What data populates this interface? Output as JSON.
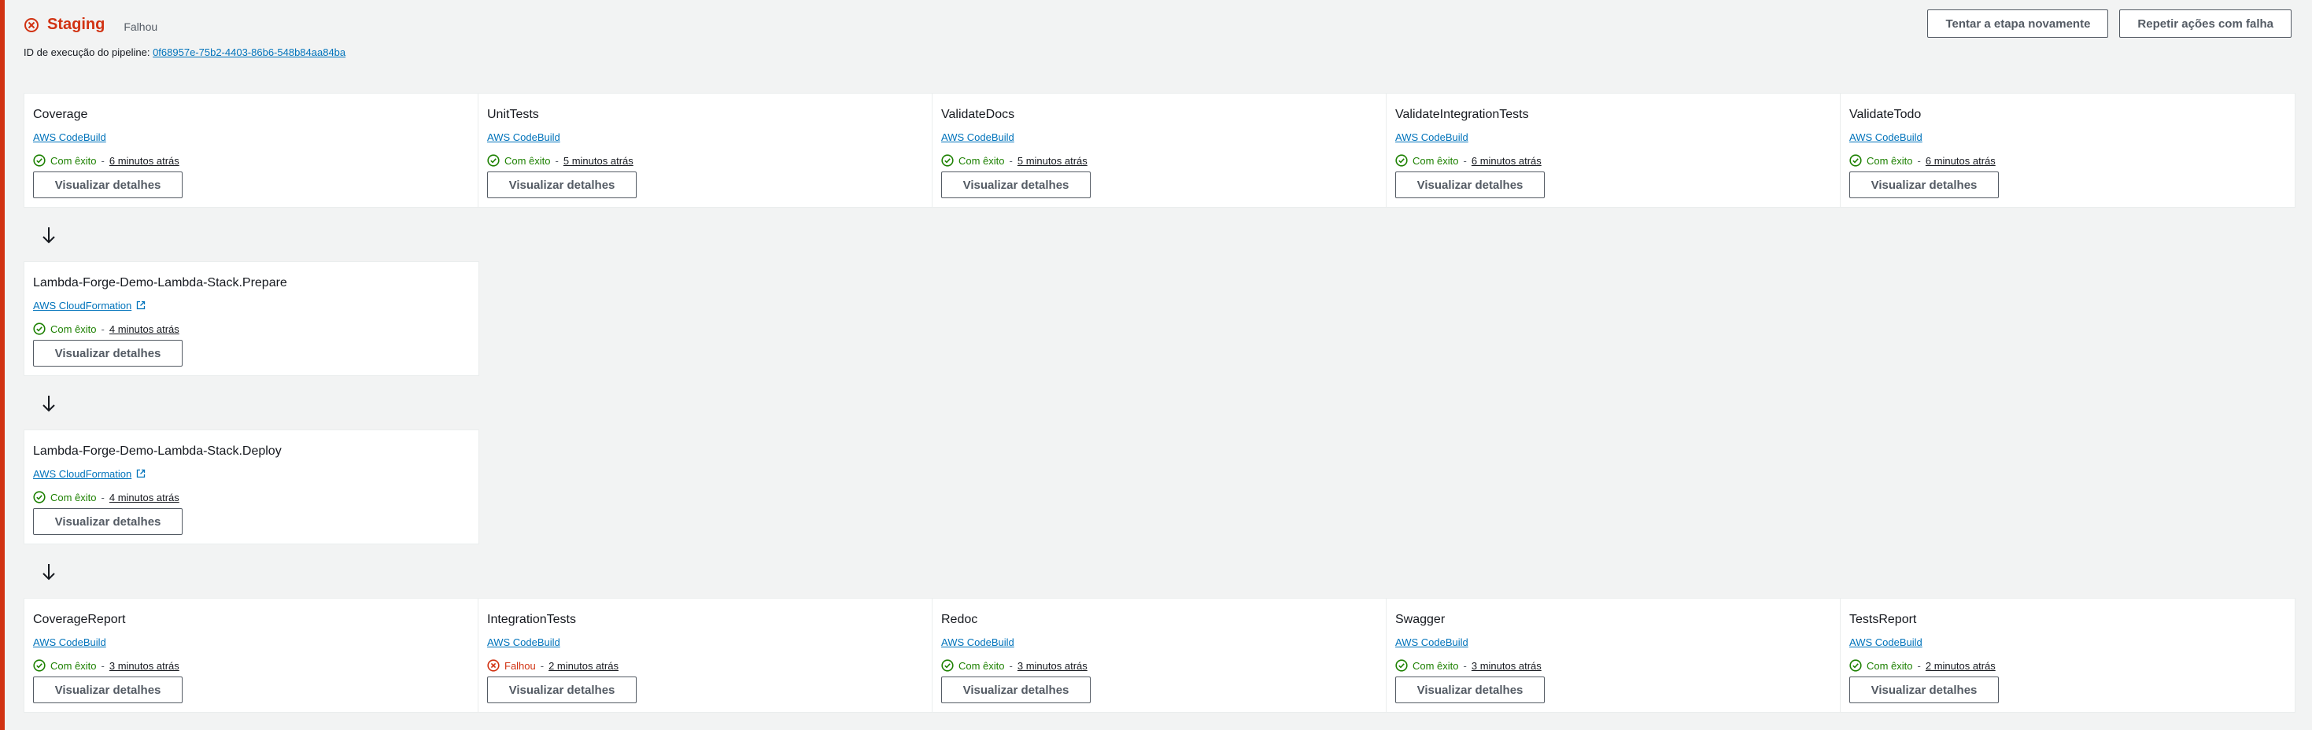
{
  "header": {
    "stage_name": "Staging",
    "stage_status": "Falhou",
    "execution_label": "ID de execução do pipeline:",
    "execution_id": "0f68957e-75b2-4403-86b6-548b84aa84ba"
  },
  "actions": {
    "retry_stage": "Tentar a etapa novamente",
    "retry_failed": "Repetir ações com falha"
  },
  "colors": {
    "failed": "#d13212",
    "success": "#1d8102",
    "link": "#0073bb"
  },
  "groups": [
    [
      {
        "name": "Coverage",
        "provider": "AWS CodeBuild",
        "status": "Com êxito",
        "time": "6 minutos atrás",
        "button": "Visualizar detalhes"
      },
      {
        "name": "UnitTests",
        "provider": "AWS CodeBuild",
        "status": "Com êxito",
        "time": "5 minutos atrás",
        "button": "Visualizar detalhes"
      },
      {
        "name": "ValidateDocs",
        "provider": "AWS CodeBuild",
        "status": "Com êxito",
        "time": "5 minutos atrás",
        "button": "Visualizar detalhes"
      },
      {
        "name": "ValidateIntegrationTests",
        "provider": "AWS CodeBuild",
        "status": "Com êxito",
        "time": "6 minutos atrás",
        "button": "Visualizar detalhes"
      },
      {
        "name": "ValidateTodo",
        "provider": "AWS CodeBuild",
        "status": "Com êxito",
        "time": "6 minutos atrás",
        "button": "Visualizar detalhes"
      }
    ],
    [
      {
        "name": "Lambda-Forge-Demo-Lambda-Stack.Prepare",
        "provider": "AWS CloudFormation",
        "status": "Com êxito",
        "time": "4 minutos atrás",
        "button": "Visualizar detalhes"
      }
    ],
    [
      {
        "name": "Lambda-Forge-Demo-Lambda-Stack.Deploy",
        "provider": "AWS CloudFormation",
        "status": "Com êxito",
        "time": "4 minutos atrás",
        "button": "Visualizar detalhes"
      }
    ],
    [
      {
        "name": "CoverageReport",
        "provider": "AWS CodeBuild",
        "status": "Com êxito",
        "time": "3 minutos atrás",
        "button": "Visualizar detalhes"
      },
      {
        "name": "IntegrationTests",
        "provider": "AWS CodeBuild",
        "status": "Falhou",
        "time": "2 minutos atrás",
        "button": "Visualizar detalhes"
      },
      {
        "name": "Redoc",
        "provider": "AWS CodeBuild",
        "status": "Com êxito",
        "time": "3 minutos atrás",
        "button": "Visualizar detalhes"
      },
      {
        "name": "Swagger",
        "provider": "AWS CodeBuild",
        "status": "Com êxito",
        "time": "3 minutos atrás",
        "button": "Visualizar detalhes"
      },
      {
        "name": "TestsReport",
        "provider": "AWS CodeBuild",
        "status": "Com êxito",
        "time": "2 minutos atrás",
        "button": "Visualizar detalhes"
      }
    ]
  ]
}
